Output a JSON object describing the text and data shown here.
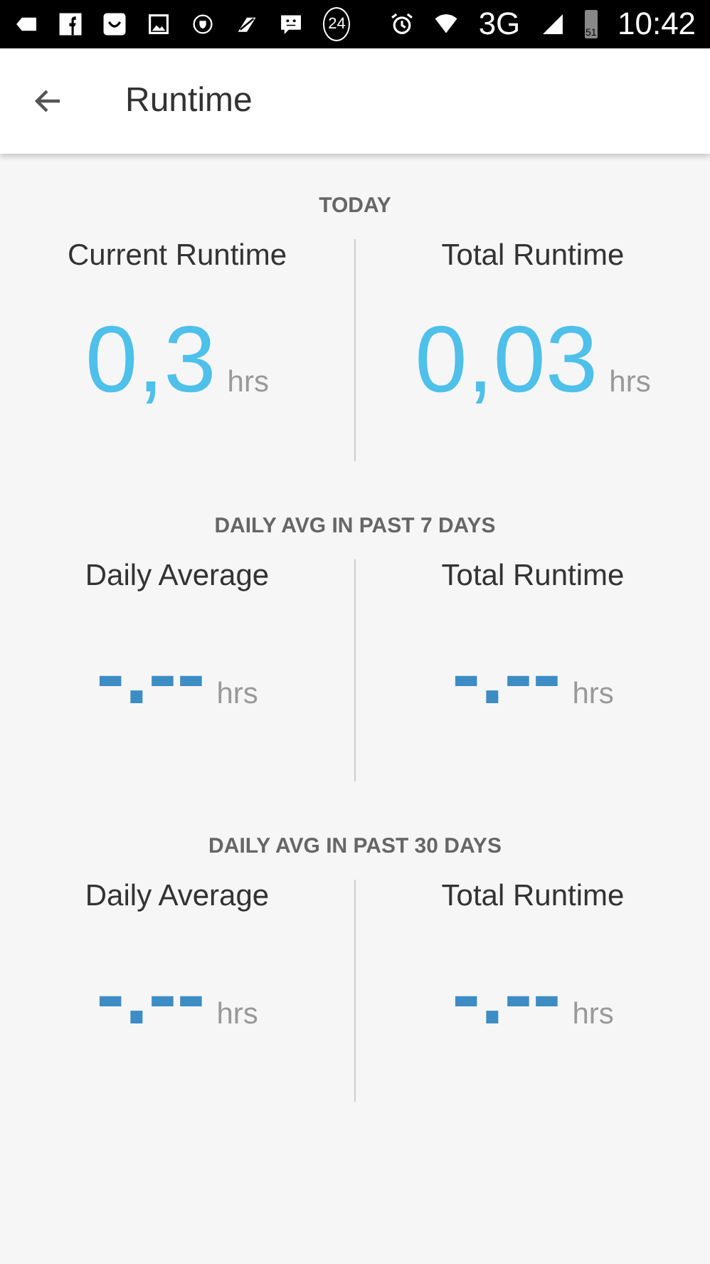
{
  "status_bar": {
    "notification_count": "24",
    "network": "3G",
    "battery": "51",
    "time": "10:42"
  },
  "app_bar": {
    "title": "Runtime"
  },
  "sections": [
    {
      "heading": "TODAY",
      "metrics": [
        {
          "label": "Current Runtime",
          "value": "0,3",
          "unit": "hrs",
          "kind": "value"
        },
        {
          "label": "Total Runtime",
          "value": "0,03",
          "unit": "hrs",
          "kind": "value"
        }
      ]
    },
    {
      "heading": "DAILY AVG IN PAST 7 DAYS",
      "metrics": [
        {
          "label": "Daily Average",
          "value": "-.--",
          "unit": "hrs",
          "kind": "empty"
        },
        {
          "label": "Total Runtime",
          "value": "-.--",
          "unit": "hrs",
          "kind": "empty"
        }
      ]
    },
    {
      "heading": "DAILY AVG IN PAST 30 DAYS",
      "metrics": [
        {
          "label": "Daily Average",
          "value": "-.--",
          "unit": "hrs",
          "kind": "empty"
        },
        {
          "label": "Total Runtime",
          "value": "-.--",
          "unit": "hrs",
          "kind": "empty"
        }
      ]
    }
  ]
}
